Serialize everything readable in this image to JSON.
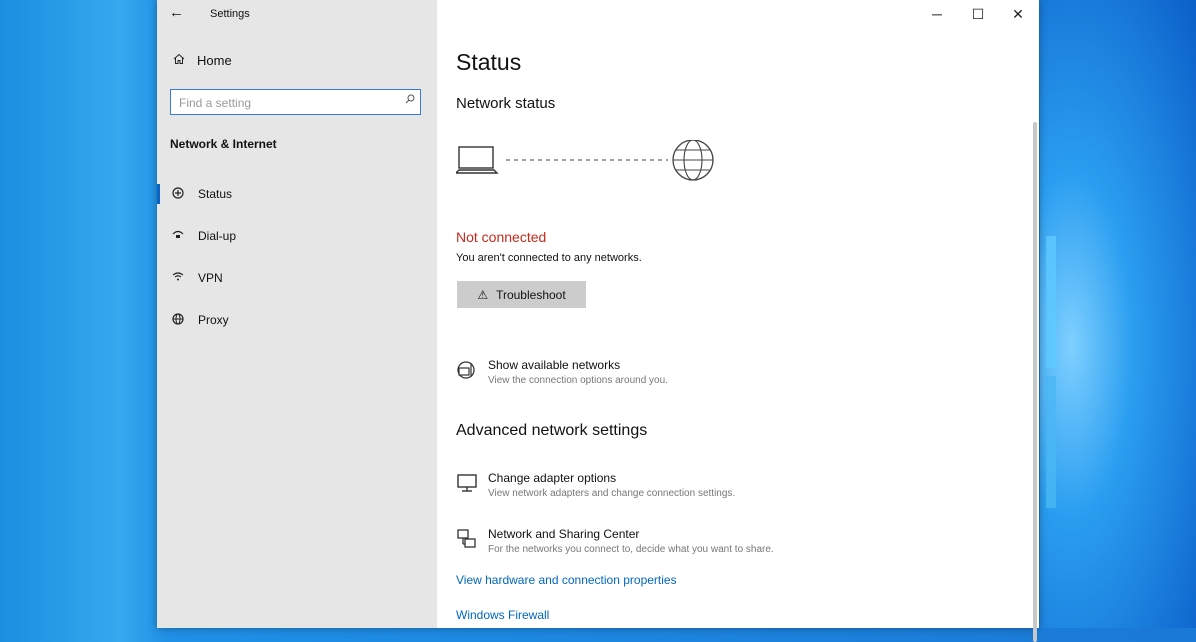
{
  "window": {
    "title": "Settings",
    "controls": {
      "minimize": "─",
      "maximize": "☐",
      "close": "✕"
    }
  },
  "sidebar": {
    "home_label": "Home",
    "search_placeholder": "Find a setting",
    "section_label": "Network & Internet",
    "items": [
      {
        "label": "Status",
        "icon": "status-icon",
        "selected": true
      },
      {
        "label": "Dial-up",
        "icon": "dialup-icon",
        "selected": false
      },
      {
        "label": "VPN",
        "icon": "vpn-icon",
        "selected": false
      },
      {
        "label": "Proxy",
        "icon": "globe-icon",
        "selected": false
      }
    ]
  },
  "main": {
    "title": "Status",
    "network_status_heading": "Network status",
    "connection_status": "Not connected",
    "connection_desc": "You aren't connected to any networks.",
    "troubleshoot_label": "Troubleshoot",
    "show_networks": {
      "title": "Show available networks",
      "desc": "View the connection options around you."
    },
    "advanced_heading": "Advanced network settings",
    "adapter_options": {
      "title": "Change adapter options",
      "desc": "View network adapters and change connection settings."
    },
    "sharing_center": {
      "title": "Network and Sharing Center",
      "desc": "For the networks you connect to, decide what you want to share."
    },
    "links": {
      "hardware_properties": "View hardware and connection properties",
      "firewall": "Windows Firewall"
    }
  },
  "colors": {
    "accent": "#0a64c8",
    "error": "#c42b1c",
    "link": "#0067c0",
    "sidebar_bg": "#e6e6e6"
  }
}
